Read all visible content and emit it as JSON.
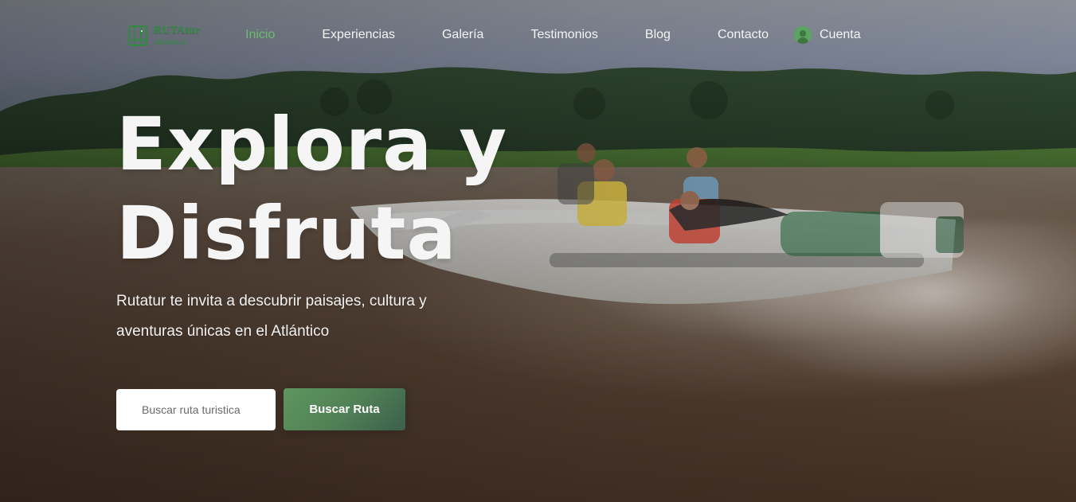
{
  "brand": {
    "title": "RUTAtur",
    "subtitle": "Atlántico",
    "colors": {
      "primary": "#2F8A3F",
      "active": "#6BBB6D"
    }
  },
  "nav": {
    "items": [
      {
        "label": "Inicio",
        "active": true
      },
      {
        "label": "Experiencias",
        "active": false
      },
      {
        "label": "Galería",
        "active": false
      },
      {
        "label": "Testimonios",
        "active": false
      },
      {
        "label": "Blog",
        "active": false
      },
      {
        "label": "Contacto",
        "active": false
      }
    ],
    "account": {
      "label": "Cuenta",
      "icon": "user-icon"
    }
  },
  "hero": {
    "title_line_1": "Explora y",
    "title_line_2": "Disfruta",
    "subtitle": "Rutatur te invita a descubrir paisajes, cultura y aventuras únicas en el Atlántico"
  },
  "search": {
    "placeholder": "Buscar ruta turistica",
    "button_label": "Buscar Ruta",
    "button_color": "#5F965E"
  }
}
